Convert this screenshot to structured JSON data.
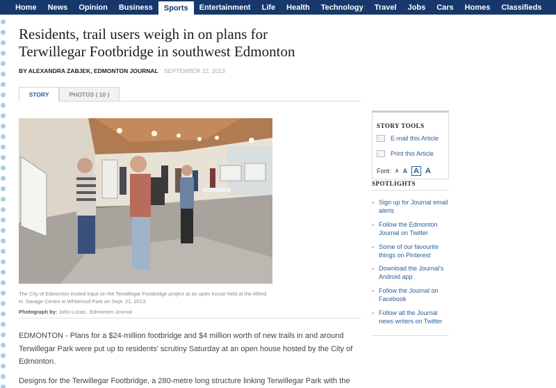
{
  "nav": {
    "items": [
      "Home",
      "News",
      "Opinion",
      "Business",
      "Sports",
      "Entertainment",
      "Life",
      "Health",
      "Technology",
      "Travel",
      "Jobs",
      "Cars",
      "Homes",
      "Classifieds"
    ],
    "active": "Sports"
  },
  "article": {
    "headline_line1": "Residents, trail users weigh in on plans for",
    "headline_line2": "Terwillegar Footbridge in southwest Edmonton",
    "byline": "BY ALEXANDRA ZABJEK, EDMONTON JOURNAL",
    "date": "SEPTEMBER 22, 2013",
    "tabs": {
      "story": "STORY",
      "photos": "PHOTOS ( 10 )"
    },
    "photo_caption": "The City of Edmonton invited input on the Terwillegar Footbridge project at an open house held at the Alfred H. Savage Centre in Whitemud Park on Sept. 21, 2013.",
    "photo_credit_label": "Photograph by:",
    "photo_credit": "John Lucas , Edmonton Journal",
    "paragraph1": "EDMONTON - Plans for a $24-million footbridge and $4 million worth of new trails in and around Terwillegar Park were put up to residents' scrutiny Saturday at an open house hosted by the City of Edmonton.",
    "paragraph2": "Designs for the Terwillegar Footbridge, a 280-metre long structure linking Terwillegar Park with the"
  },
  "story_tools": {
    "title": "STORY TOOLS",
    "email": "E-mail this Article",
    "print": "Print this Article",
    "font_label": "Font:",
    "font_sizes": [
      "A",
      "A",
      "A",
      "A"
    ]
  },
  "spotlights": {
    "title": "SPOTLIGHTS",
    "items": [
      "Sign up for Journal email alerts",
      "Follow the Edmonton Journal on Twitter",
      "Some of our favourite things on Pinterest",
      "Download the Journal's Android app",
      "Follow the Journal on Facebook",
      "Follow all the Journal news writers on Twitter"
    ]
  },
  "colors": {
    "nav_bg": "#16386b",
    "link": "#2a5d9a",
    "dots": "#a9cde3"
  }
}
